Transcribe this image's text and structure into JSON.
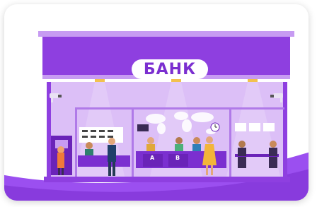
{
  "sign": {
    "text": "БАНК"
  },
  "windows": [
    {
      "label": "A"
    },
    {
      "label": "B"
    }
  ],
  "colors": {
    "primary": "#8e3fe0",
    "light": "#c79bf2",
    "glass": "#dcbff7",
    "dark": "#6a23b8",
    "floor": "#7b2fd0"
  }
}
